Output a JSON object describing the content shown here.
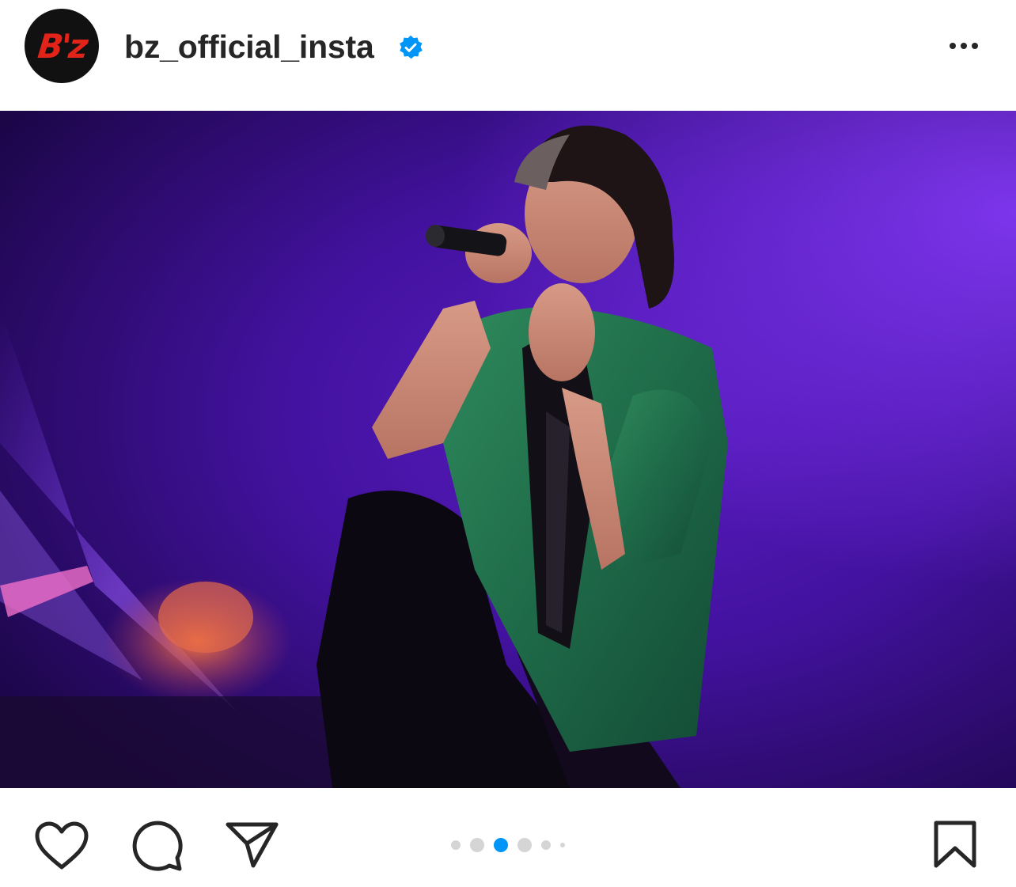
{
  "post": {
    "avatar_logo": "B'z",
    "username": "bz_official_insta",
    "verified_icon": "verified-badge-icon",
    "more_icon": "more-horizontal-icon",
    "image_alt": "Singer performing on stage with microphone under purple lights",
    "carousel": {
      "total_dots": 6,
      "active_index": 2
    },
    "actions": {
      "like_icon": "heart-icon",
      "comment_icon": "comment-icon",
      "share_icon": "send-icon",
      "save_icon": "bookmark-icon"
    },
    "colors": {
      "accent": "#0095f6",
      "text": "#262626",
      "logo_red": "#e2231a"
    }
  }
}
